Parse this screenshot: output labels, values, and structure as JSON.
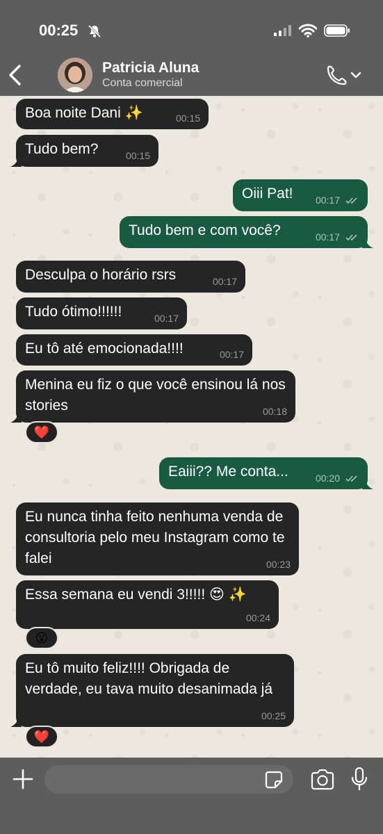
{
  "status_bar": {
    "time": "00:25"
  },
  "header": {
    "name": "Patricia Aluna",
    "subtitle": "Conta comercial"
  },
  "messages": [
    {
      "dir": "in",
      "text": "Boa noite Dani ✨",
      "time": "00:15"
    },
    {
      "dir": "in",
      "text": "Tudo bem?",
      "time": "00:15"
    },
    {
      "dir": "out",
      "text": "Oiii Pat!",
      "time": "00:17"
    },
    {
      "dir": "out",
      "text": "Tudo bem e com você?",
      "time": "00:17"
    },
    {
      "dir": "in",
      "text": "Desculpa o horário rsrs",
      "time": "00:17"
    },
    {
      "dir": "in",
      "text": "Tudo ótimo!!!!!!",
      "time": "00:17"
    },
    {
      "dir": "in",
      "text": "Eu tô até emocionada!!!!",
      "time": "00:17"
    },
    {
      "dir": "in",
      "text": "Menina eu fiz o que você ensinou lá nos stories",
      "time": "00:18",
      "reaction": "❤️"
    },
    {
      "dir": "out",
      "text": "Eaiii?? Me conta...",
      "time": "00:20"
    },
    {
      "dir": "in",
      "text": "Eu nunca tinha feito nenhuma venda de consultoria pelo meu Instagram como te falei",
      "time": "00:23"
    },
    {
      "dir": "in",
      "text": "Essa semana eu vendi 3!!!!! 😍 ✨",
      "time": "00:24",
      "reaction": "😮"
    },
    {
      "dir": "in",
      "text": "Eu tô muito feliz!!!! Obrigada de verdade, eu tava muito desanimada já",
      "time": "00:25",
      "reaction": "❤️"
    }
  ],
  "composer": {
    "placeholder": "",
    "value": ""
  },
  "colors": {
    "incoming": "#252525",
    "outgoing": "#195a43",
    "bar": "#5d5d5d"
  }
}
